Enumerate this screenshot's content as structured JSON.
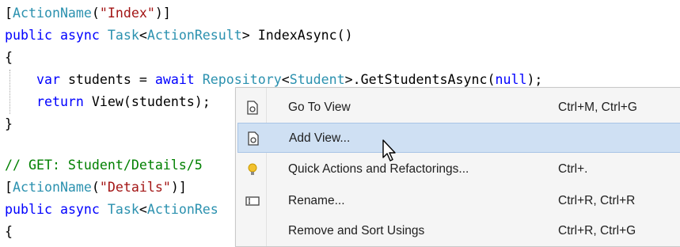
{
  "code_colors": {
    "keyword": "#0000ff",
    "type": "#2b91af",
    "string": "#a31515",
    "comment": "#008000",
    "plain": "#000000"
  },
  "code_lines": [
    [
      {
        "t": "[",
        "k": "plain"
      },
      {
        "t": "ActionName",
        "k": "type"
      },
      {
        "t": "(",
        "k": "plain"
      },
      {
        "t": "\"Index\"",
        "k": "string"
      },
      {
        "t": ")]",
        "k": "plain"
      }
    ],
    [
      {
        "t": "public",
        "k": "keyword"
      },
      {
        "t": " ",
        "k": "plain"
      },
      {
        "t": "async",
        "k": "keyword"
      },
      {
        "t": " ",
        "k": "plain"
      },
      {
        "t": "Task",
        "k": "type"
      },
      {
        "t": "<",
        "k": "plain"
      },
      {
        "t": "ActionResult",
        "k": "type"
      },
      {
        "t": "> IndexAsync()",
        "k": "plain"
      }
    ],
    [
      {
        "t": "{",
        "k": "plain"
      }
    ],
    [
      {
        "t": "    ",
        "k": "plain"
      },
      {
        "t": "var",
        "k": "keyword"
      },
      {
        "t": " students = ",
        "k": "plain"
      },
      {
        "t": "await",
        "k": "keyword"
      },
      {
        "t": " ",
        "k": "plain"
      },
      {
        "t": "Repository",
        "k": "type"
      },
      {
        "t": "<",
        "k": "plain"
      },
      {
        "t": "Student",
        "k": "type"
      },
      {
        "t": ">.GetStudentsAsync(",
        "k": "plain"
      },
      {
        "t": "null",
        "k": "keyword"
      },
      {
        "t": ");",
        "k": "plain"
      }
    ],
    [
      {
        "t": "    ",
        "k": "plain"
      },
      {
        "t": "return",
        "k": "keyword"
      },
      {
        "t": " View(students);",
        "k": "plain"
      }
    ],
    [
      {
        "t": "}",
        "k": "plain"
      }
    ],
    [
      {
        "t": "",
        "k": "plain"
      }
    ],
    [
      {
        "t": "// GET: Student/Details/5",
        "k": "comment"
      }
    ],
    [
      {
        "t": "[",
        "k": "plain"
      },
      {
        "t": "ActionName",
        "k": "type"
      },
      {
        "t": "(",
        "k": "plain"
      },
      {
        "t": "\"Details\"",
        "k": "string"
      },
      {
        "t": ")]",
        "k": "plain"
      }
    ],
    [
      {
        "t": "public",
        "k": "keyword"
      },
      {
        "t": " ",
        "k": "plain"
      },
      {
        "t": "async",
        "k": "keyword"
      },
      {
        "t": " ",
        "k": "plain"
      },
      {
        "t": "Task",
        "k": "type"
      },
      {
        "t": "<",
        "k": "plain"
      },
      {
        "t": "ActionRes",
        "k": "type"
      }
    ],
    [
      {
        "t": "{",
        "k": "plain"
      }
    ]
  ],
  "context_menu": {
    "highlight_color": "#cfe0f3",
    "items": [
      {
        "label": "Go To View",
        "shortcut": "Ctrl+M, Ctrl+G",
        "icon": "view-file-icon",
        "highlighted": false
      },
      {
        "label": "Add View...",
        "shortcut": "",
        "icon": "view-file-icon",
        "highlighted": true
      },
      {
        "label": "Quick Actions and Refactorings...",
        "shortcut": "Ctrl+.",
        "icon": "lightbulb-icon",
        "highlighted": false
      },
      {
        "label": "Rename...",
        "shortcut": "Ctrl+R, Ctrl+R",
        "icon": "rename-icon",
        "highlighted": false
      },
      {
        "label": "Remove and Sort Usings",
        "shortcut": "Ctrl+R, Ctrl+G",
        "icon": "",
        "highlighted": false
      }
    ]
  },
  "cursor_icon": "mouse-pointer-icon"
}
